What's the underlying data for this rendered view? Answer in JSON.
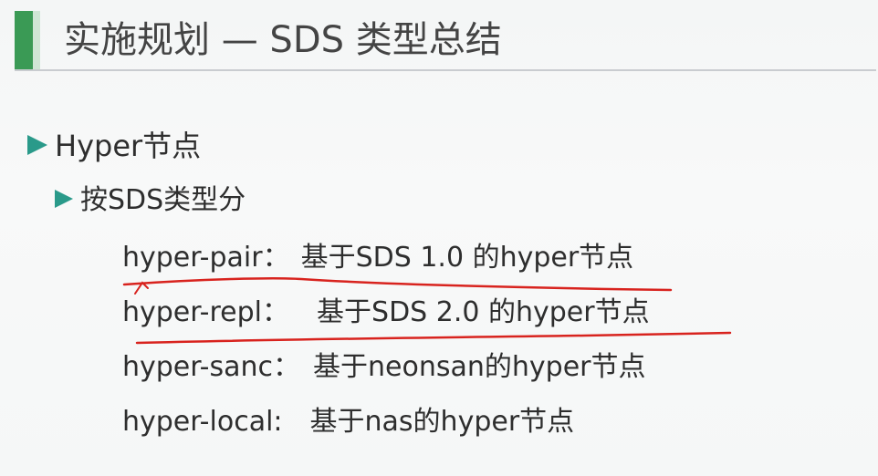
{
  "slide": {
    "title": "实施规划 — SDS 类型总结",
    "accent_color": "#3a9a55",
    "bullet_color": "#2a9a8a",
    "annotation_color": "#d8231e"
  },
  "bullets": [
    {
      "label": "Hyper节点",
      "children": [
        {
          "label": "按SDS类型分",
          "items": [
            {
              "key": "hyper-pair：",
              "desc": "基于SDS 1.0 的hyper节点"
            },
            {
              "key": "hyper-repl：",
              "desc": "基于SDS 2.0 的hyper节点"
            },
            {
              "key": "hyper-sanc：",
              "desc": "基于neonsan的hyper节点"
            },
            {
              "key": "hyper-local:",
              "desc": "基于nas的hyper节点"
            }
          ]
        }
      ]
    }
  ]
}
